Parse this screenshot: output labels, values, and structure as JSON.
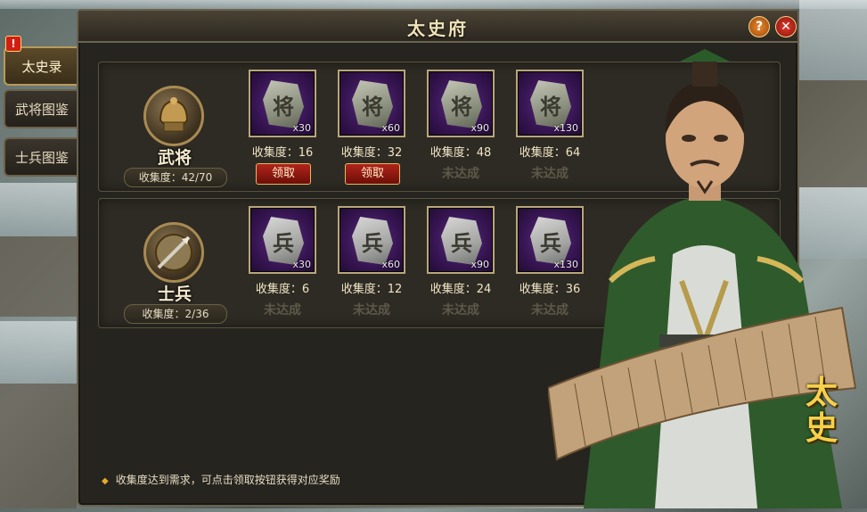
{
  "window": {
    "title": "太史府"
  },
  "side_tabs": [
    {
      "label": "太史录",
      "active": true,
      "alert": "!"
    },
    {
      "label": "武将图鉴",
      "active": false
    },
    {
      "label": "士兵图鉴",
      "active": false
    }
  ],
  "categories": [
    {
      "name": "武将",
      "progress_label": "收集度：42/70",
      "progress": {
        "current": 42,
        "total": 70
      },
      "tiers": [
        {
          "glyph": "将",
          "count": "x30",
          "req": "收集度：16",
          "status": "领取",
          "claimable": true
        },
        {
          "glyph": "将",
          "count": "x60",
          "req": "收集度：32",
          "status": "领取",
          "claimable": true
        },
        {
          "glyph": "将",
          "count": "x90",
          "req": "收集度：48",
          "status": "未达成",
          "claimable": false
        },
        {
          "glyph": "将",
          "count": "x130",
          "req": "收集度：64",
          "status": "未达成",
          "claimable": false
        }
      ]
    },
    {
      "name": "士兵",
      "progress_label": "收集度：2/36",
      "progress": {
        "current": 2,
        "total": 36
      },
      "tiers": [
        {
          "glyph": "兵",
          "count": "x30",
          "req": "收集度：6",
          "status": "未达成",
          "claimable": false
        },
        {
          "glyph": "兵",
          "count": "x60",
          "req": "收集度：12",
          "status": "未达成",
          "claimable": false
        },
        {
          "glyph": "兵",
          "count": "x90",
          "req": "收集度：24",
          "status": "未达成",
          "claimable": false
        },
        {
          "glyph": "兵",
          "count": "x130",
          "req": "收集度：36",
          "status": "未达成",
          "claimable": false
        }
      ]
    }
  ],
  "footer_note": "收集度达到需求，可点击领取按钮获得对应奖励",
  "character_seal": "太史",
  "icons": {
    "help": "question-icon",
    "close": "close-icon"
  },
  "colors": {
    "accent_gold": "#e3b861",
    "claim_red": "#b0241a",
    "slot_purple": "#5c2f86"
  }
}
